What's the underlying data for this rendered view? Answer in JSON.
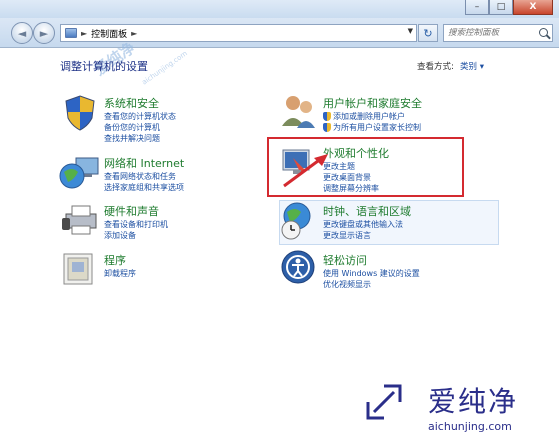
{
  "window": {
    "minimize": "–",
    "maximize": "□",
    "close": "X"
  },
  "nav": {
    "back": "◄",
    "forward": "►",
    "breadcrumb": "控制面板",
    "refresh": "↻",
    "search_placeholder": "搜索控制面板"
  },
  "header": {
    "title": "调整计算机的设置",
    "view_by_label": "查看方式:",
    "view_by_value": "类别 ▾"
  },
  "categories": {
    "system": {
      "title": "系统和安全",
      "links": [
        "查看您的计算机状态",
        "备份您的计算机",
        "查找并解决问题"
      ]
    },
    "network": {
      "title": "网络和 Internet",
      "links": [
        "查看网络状态和任务",
        "选择家庭组和共享选项"
      ]
    },
    "hardware": {
      "title": "硬件和声音",
      "links": [
        "查看设备和打印机",
        "添加设备"
      ]
    },
    "programs": {
      "title": "程序",
      "links": [
        "卸载程序"
      ]
    },
    "user": {
      "title": "用户帐户和家庭安全",
      "links": [
        "添加或删除用户帐户",
        "为所有用户设置家长控制"
      ]
    },
    "appearance": {
      "title": "外观和个性化",
      "links": [
        "更改主题",
        "更改桌面背景",
        "调整屏幕分辨率"
      ]
    },
    "clock": {
      "title": "时钟、语言和区域",
      "links": [
        "更改键盘或其他输入法",
        "更改显示语言"
      ]
    },
    "access": {
      "title": "轻松访问",
      "links": [
        "使用 Windows 建议的设置",
        "优化视频显示"
      ]
    }
  },
  "watermark": {
    "mark": "爱纯净",
    "url": "aichunjing.com"
  },
  "logo": {
    "text": "爱纯净",
    "url": "aichunjing.com"
  },
  "colors": {
    "highlight": "#d42a30",
    "category_title": "#1e7b2e",
    "link": "#1e50a2"
  }
}
